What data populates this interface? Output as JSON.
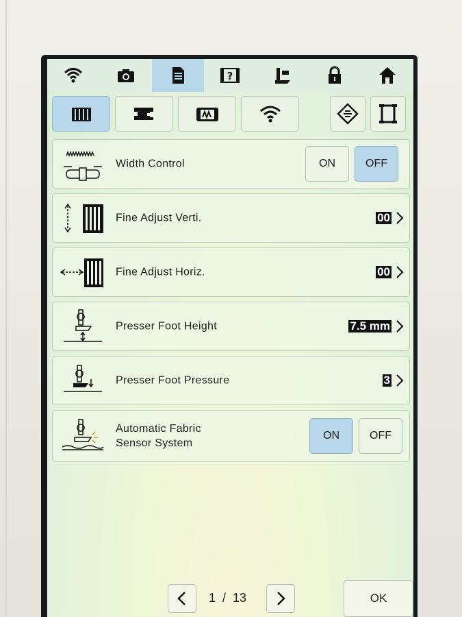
{
  "top_tabs": [
    {
      "icon": "wifi-icon"
    },
    {
      "icon": "camera-icon"
    },
    {
      "icon": "settings-document-icon"
    },
    {
      "icon": "help-video-icon"
    },
    {
      "icon": "sewing-machine-icon"
    },
    {
      "icon": "lock-icon"
    },
    {
      "icon": "home-icon"
    }
  ],
  "category_tabs": [
    {
      "icon": "sewing-settings-icon"
    },
    {
      "icon": "embroidery-settings-icon"
    },
    {
      "icon": "display-settings-icon"
    },
    {
      "icon": "wireless-settings-icon"
    },
    {
      "icon": "layer-icon"
    },
    {
      "icon": "frame-icon"
    }
  ],
  "settings": [
    {
      "label": "Width Control",
      "on_label": "ON",
      "off_label": "OFF",
      "state": "OFF"
    },
    {
      "label": "Fine Adjust Verti.",
      "value": "00"
    },
    {
      "label": "Fine Adjust Horiz.",
      "value": "00"
    },
    {
      "label": "Presser Foot Height",
      "value": "7.5 mm"
    },
    {
      "label": "Presser Foot Pressure",
      "value": "3"
    },
    {
      "label": "Automatic Fabric\nSensor System",
      "on_label": "ON",
      "off_label": "OFF",
      "state": "ON"
    }
  ],
  "pagination": {
    "current": "1",
    "separator": "/",
    "total": "13",
    "text": "1  /  13"
  },
  "ok_label": "OK",
  "colors": {
    "selected": "#b8d7ea",
    "screen": "#e8f3dc",
    "value_bg": "#111111"
  }
}
